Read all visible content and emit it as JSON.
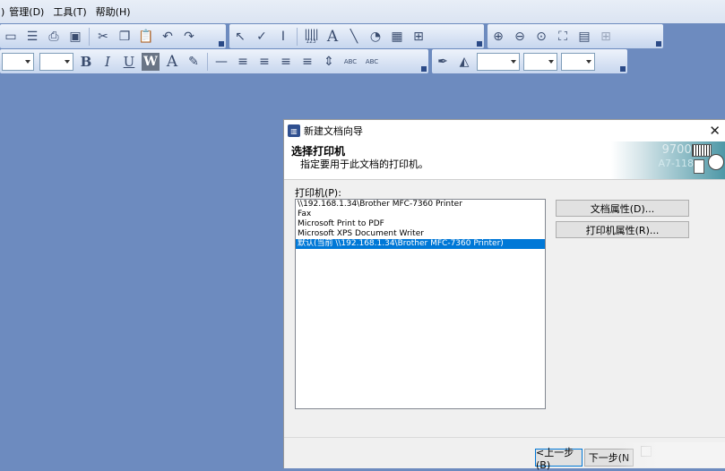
{
  "menu": {
    "edge": ")",
    "items": [
      "管理(D)",
      "工具(T)",
      "帮助(H)"
    ]
  },
  "toolbar": {
    "align_glyph": "≡",
    "bold": "B",
    "italic": "I",
    "underline": "U",
    "wrap": "W",
    "font_color": "A",
    "text_tool": "A",
    "abc1": "ABC",
    "abc2": "ABC",
    "barcode_label": "123"
  },
  "dialog": {
    "title": "新建文档向导",
    "close": "✕",
    "header_title": "选择打印机",
    "header_subtitle": "指定要用于此文档的打印机。",
    "banner_text1": "97001",
    "banner_text2": "A7-118",
    "printer_label": "打印机(P):",
    "printers": [
      "\\\\192.168.1.34\\Brother MFC-7360 Printer",
      "Fax",
      "Microsoft Print to PDF",
      "Microsoft XPS Document Writer",
      "默认(当前 \\\\192.168.1.34\\Brother MFC-7360 Printer)"
    ],
    "selected_index": 4,
    "doc_props_button": "文档属性(D)...",
    "printer_props_button": "打印机属性(R)...",
    "back_button": "<上一步(B)",
    "next_button": "下一步(N"
  },
  "colors": {
    "desktop": "#6d8bbf",
    "selection": "#0078d7"
  }
}
